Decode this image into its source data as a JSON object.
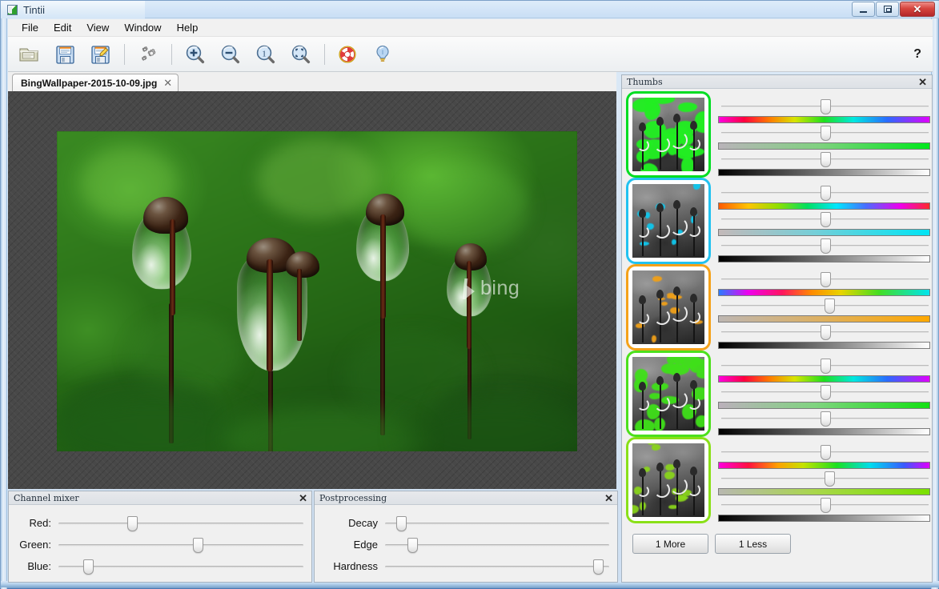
{
  "window": {
    "app_title": "Tintii",
    "app_icon": "app-icon",
    "buttons": {
      "minimize": "–",
      "restore": "□",
      "close": "✕"
    }
  },
  "menubar": {
    "items": [
      {
        "label": "File"
      },
      {
        "label": "Edit"
      },
      {
        "label": "View"
      },
      {
        "label": "Window"
      },
      {
        "label": "Help"
      }
    ]
  },
  "toolbar": {
    "help_glyph": "?",
    "buttons": [
      {
        "name": "open-file-button",
        "icon": "folder-open-icon"
      },
      {
        "name": "save-button",
        "icon": "floppy-save-icon"
      },
      {
        "name": "save-as-button",
        "icon": "floppy-save-as-icon"
      },
      {
        "name": "settings-button",
        "icon": "gears-icon"
      },
      {
        "name": "zoom-in-button",
        "icon": "magnifier-plus-icon"
      },
      {
        "name": "zoom-out-button",
        "icon": "magnifier-minus-icon"
      },
      {
        "name": "zoom-actual-button",
        "icon": "magnifier-one-icon"
      },
      {
        "name": "zoom-fit-button",
        "icon": "magnifier-fit-icon"
      },
      {
        "name": "support-button",
        "icon": "lifebuoy-icon"
      },
      {
        "name": "tips-button",
        "icon": "lightbulb-icon"
      }
    ]
  },
  "tabs": [
    {
      "label": "BingWallpaper-2015-10-09.jpg",
      "close": "✕",
      "active": true
    }
  ],
  "canvas": {
    "image_watermark": "bing"
  },
  "channel_mixer": {
    "title": "Channel mixer",
    "close": "✕",
    "sliders": [
      {
        "label": "Red:",
        "value": 30
      },
      {
        "label": "Green:",
        "value": 57
      },
      {
        "label": "Blue:",
        "value": 12
      }
    ]
  },
  "postprocessing": {
    "title": "Postprocessing",
    "close": "✕",
    "sliders": [
      {
        "label": "Decay",
        "value": 7
      },
      {
        "label": "Edge",
        "value": 12
      },
      {
        "label": "Hardness",
        "value": 95
      }
    ]
  },
  "thumbs": {
    "title": "Thumbs",
    "close": "✕",
    "more_label": "1 More",
    "less_label": "1 Less",
    "items": [
      {
        "name": "thumb-green-heavy",
        "border_color": "#00dd22",
        "tint_color": "#22ee22",
        "coverage": "heavy",
        "hue_slider": 50,
        "sat_slider": 50,
        "lum_slider": 50,
        "hue_gradient": "linear-gradient(90deg,#ff00e0 0%,#ff0040 12%,#ff7a00 24%,#d8e400 36%,#1ee01e 50%,#00e8e0 64%,#2a6bff 80%,#e000ff 100%)",
        "sat_gradient": "linear-gradient(90deg,#b9b3b9 0%,#7fd17f 48%,#00e81c 100%)",
        "lum_gradient": "linear-gradient(90deg,#000000 0%,#8a8a8a 58%,#ffffff 100%)"
      },
      {
        "name": "thumb-cyan",
        "border_color": "#22c2f0",
        "tint_color": "#0ec8ee",
        "coverage": "light",
        "hue_slider": 50,
        "sat_slider": 50,
        "lum_slider": 50,
        "hue_gradient": "linear-gradient(90deg,#ff5a00 0%,#ffc400 14%,#8fe000 28%,#00e060 42%,#00e6ff 56%,#4a6cff 70%,#ee00ee 86%,#ff2a2a 100%)",
        "sat_gradient": "linear-gradient(90deg,#c3b9b9 0%,#74cfd8 46%,#00e4f4 100%)",
        "lum_gradient": "linear-gradient(90deg,#000000 0%,#8a8a8a 58%,#ffffff 100%)"
      },
      {
        "name": "thumb-orange",
        "border_color": "#f5a21a",
        "tint_color": "#f0a018",
        "coverage": "light",
        "hue_slider": 50,
        "sat_slider": 52,
        "lum_slider": 50,
        "hue_gradient": "linear-gradient(90deg,#2a7bff 0%,#ee00ee 14%,#ff1560 30%,#ff8a00 44%,#e8d400 58%,#44dd22 76%,#00e4ee 100%)",
        "sat_gradient": "linear-gradient(90deg,#bdb6b2 0%,#ddb062 48%,#ffa800 100%)",
        "lum_gradient": "linear-gradient(90deg,#000000 0%,#8a8a8a 58%,#ffffff 100%)"
      },
      {
        "name": "thumb-green-mid",
        "border_color": "#4ce01c",
        "tint_color": "#3fe019",
        "coverage": "medium",
        "hue_slider": 50,
        "sat_slider": 50,
        "lum_slider": 50,
        "hue_gradient": "linear-gradient(90deg,#ff00e0 0%,#ff0040 12%,#ff7a00 24%,#d8e400 36%,#1ee01e 50%,#00e8e0 64%,#2a6bff 80%,#e000ff 100%)",
        "sat_gradient": "linear-gradient(90deg,#bbb0bb 0%,#7fd47f 46%,#14e014 100%)",
        "lum_gradient": "linear-gradient(90deg,#000000 0%,#8a8a8a 58%,#ffffff 100%)"
      },
      {
        "name": "thumb-yellowgreen",
        "border_color": "#8ae018",
        "tint_color": "#8ad61a",
        "coverage": "sparse",
        "hue_slider": 50,
        "sat_slider": 52,
        "lum_slider": 50,
        "hue_gradient": "linear-gradient(90deg,#ff00dd 0%,#ff1040 14%,#ffa000 28%,#c6e200 40%,#1ce020 56%,#00dcee 72%,#3a5aff 88%,#e000ff 100%)",
        "sat_gradient": "linear-gradient(90deg,#b8b8b0 0%,#a9d74a 46%,#7ae000 100%)",
        "lum_gradient": "linear-gradient(90deg,#000000 0%,#8a8a8a 58%,#ffffff 100%)"
      }
    ]
  }
}
